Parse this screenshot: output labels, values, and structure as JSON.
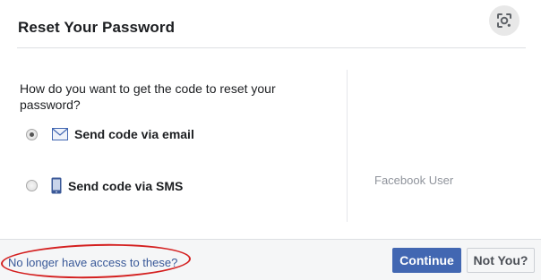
{
  "dialog": {
    "title": "Reset Your Password",
    "question": "How do you want to get the code to reset your password?",
    "options": [
      {
        "label": "Send code via email",
        "icon": "envelope-icon",
        "selected": true
      },
      {
        "label": "Send code via SMS",
        "icon": "phone-icon",
        "selected": false
      }
    ],
    "user_name": "Facebook User"
  },
  "footer": {
    "access_link": "No longer have access to these?",
    "continue_label": "Continue",
    "not_you_label": "Not You?"
  },
  "overlay": {
    "lens_icon": "google-lens-icon"
  },
  "colors": {
    "primary": "#4267b2",
    "link": "#385898",
    "annotation": "#d42020"
  }
}
